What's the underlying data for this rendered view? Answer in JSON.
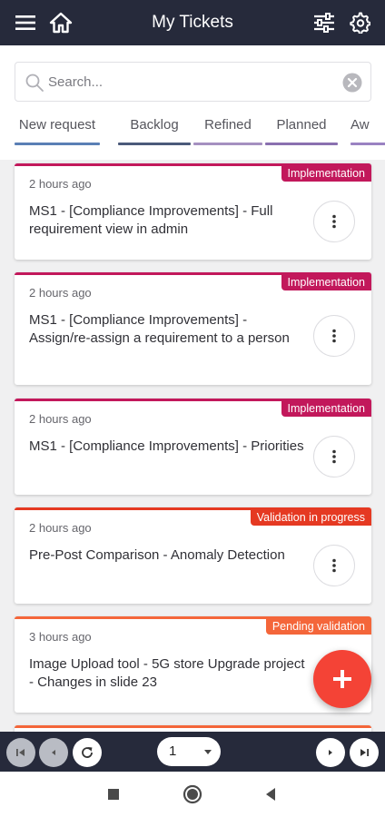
{
  "header": {
    "title": "My Tickets",
    "icons": [
      "menu-icon",
      "home-icon",
      "filter-icon",
      "settings-icon"
    ]
  },
  "search": {
    "placeholder": "Search...",
    "value": ""
  },
  "tabs": [
    {
      "label": "New request",
      "color": "#5a7fb5"
    },
    {
      "label": "Backlog",
      "color": "#4b5a7a"
    },
    {
      "label": "Refined",
      "color": "#a590c0"
    },
    {
      "label": "Planned",
      "color": "#8a70b0"
    },
    {
      "label": "Aw",
      "color": "#9a82c2"
    }
  ],
  "tickets": [
    {
      "time": "2 hours ago",
      "title": "MS1 - [Compliance Improvements] - Full requirement view in admin",
      "badge": "Implementation",
      "color": "#c2185b"
    },
    {
      "time": "2 hours ago",
      "title": "MS1 - [Compliance Improvements] - Assign/re-assign a requirement to a person",
      "badge": "Implementation",
      "color": "#c2185b"
    },
    {
      "time": "2 hours ago",
      "title": "MS1 - [Compliance Improvements] - Priorities",
      "badge": "Implementation",
      "color": "#c2185b"
    },
    {
      "time": "2 hours ago",
      "title": "Pre-Post Comparison - Anomaly Detection",
      "badge": "Validation in progress",
      "color": "#e53922"
    },
    {
      "time": "3 hours ago",
      "title": "Image Upload tool - 5G store Upgrade project - Changes in slide 23",
      "badge": "Pending validation",
      "color": "#f4663a"
    }
  ],
  "fab_icon": "add-icon",
  "pagination": {
    "current_page": "1",
    "icons": [
      "first-page-icon",
      "prev-page-icon",
      "refresh-icon",
      "next-page-icon",
      "last-page-icon"
    ]
  },
  "system_nav": {
    "icons": [
      "recents-icon",
      "home-circle-icon",
      "back-icon"
    ]
  },
  "colors": {
    "header_bg": "#262a3b",
    "fab": "#f44336"
  }
}
